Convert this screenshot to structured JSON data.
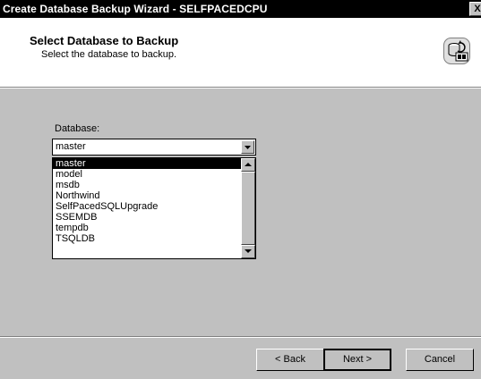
{
  "window": {
    "title": "Create Database Backup Wizard - SELFPACEDCPU",
    "close_glyph": "X"
  },
  "header": {
    "heading": "Select Database to Backup",
    "subheading": "Select the database to backup.",
    "icon": "database-backup-icon"
  },
  "form": {
    "database_label": "Database:",
    "selected_value": "master",
    "options": [
      "master",
      "model",
      "msdb",
      "Northwind",
      "SelfPacedSQLUpgrade",
      "SSEMDB",
      "tempdb",
      "TSQLDB"
    ],
    "highlighted_index": 0
  },
  "buttons": {
    "back": "< Back",
    "next": "Next >",
    "cancel": "Cancel"
  }
}
